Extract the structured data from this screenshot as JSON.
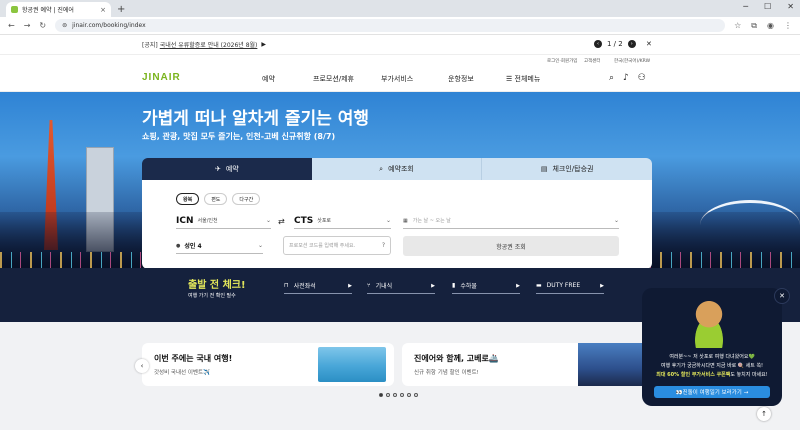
{
  "browser": {
    "tab_title": "항공권 예약 | 진에어",
    "url": "jinair.com/booking/index",
    "new_tab": "+",
    "tab_close": "×"
  },
  "notice": {
    "tag": "[공지]",
    "text": "국내선 유류할증료 안내 (2026년 8월)",
    "page": "1 / 2",
    "prev": "‹",
    "next": "›",
    "close": "✕"
  },
  "util_links": [
    "로그인·회원가입",
    "고객센터",
    "한국(한국어)/KRW"
  ],
  "logo": "JINAIR",
  "menu": [
    "예약",
    "프로모션/제휴",
    "부가서비스",
    "운항정보",
    "전체메뉴"
  ],
  "hero": {
    "title": "가볍게 떠나 알차게 즐기는 여행",
    "subtitle": "쇼핑, 관광, 맛집 모두 즐기는, 인천-고베 신규취항 (8/7)"
  },
  "booking": {
    "tabs": [
      "예약",
      "예약조회",
      "체크인/탑승권"
    ],
    "trip_types": [
      "왕복",
      "편도",
      "다구간"
    ],
    "from_code": "ICN",
    "from_name": "서울/인천",
    "to_code": "CTS",
    "to_name": "삿포로",
    "date_placeholder": "가는 날 ~ 오는 날",
    "passengers": "성인 4",
    "promo_placeholder": "프로모션 코드를 입력해 주세요.",
    "search_label": "항공권 조회"
  },
  "checkin": {
    "title": "출발 전 체크!",
    "subtitle": "여행 가기 전 확인 필수",
    "items": [
      {
        "icon": "seat-icon",
        "label": "사전좌석"
      },
      {
        "icon": "meal-icon",
        "label": "기내식"
      },
      {
        "icon": "baggage-icon",
        "label": "수하물"
      },
      {
        "icon": "dutyfree-icon",
        "label": "DUTY FREE"
      }
    ]
  },
  "promos": [
    {
      "title": "이번 주에는 국내 여행!",
      "sub": "갓성비 국내선 이벤트✈️"
    },
    {
      "title": "진에어와 함께, 고베로🚢",
      "sub": "신규 취항 기념 할인 이벤트!"
    }
  ],
  "popup": {
    "line1": "여러분~~ 저 삿포로 여행 다녀왔어요💚",
    "line2": "여행 후기가 궁금하시다면 지금 바로 🍭 세트 쏙!",
    "line3_highlight": "최대 60% 할인 부가서비스 쿠폰팩",
    "line3_rest": "도 놓치지 마세요!",
    "button": "👀진돌이 여행일기 보러가기 →"
  }
}
